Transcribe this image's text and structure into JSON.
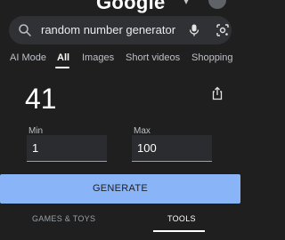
{
  "header": {
    "logo": "Google"
  },
  "search": {
    "query": "random number generator"
  },
  "tabs": [
    {
      "label": "AI Mode"
    },
    {
      "label": "All"
    },
    {
      "label": "Images"
    },
    {
      "label": "Short videos"
    },
    {
      "label": "Shopping"
    }
  ],
  "rng": {
    "result": "41",
    "min_label": "Min",
    "min_value": "1",
    "max_label": "Max",
    "max_value": "100",
    "generate_label": "GENERATE"
  },
  "bottom_tabs": [
    {
      "label": "GAMES & TOYS"
    },
    {
      "label": "TOOLS"
    }
  ],
  "colors": {
    "background": "#1f1f1f",
    "accent": "#8ab4f8"
  }
}
